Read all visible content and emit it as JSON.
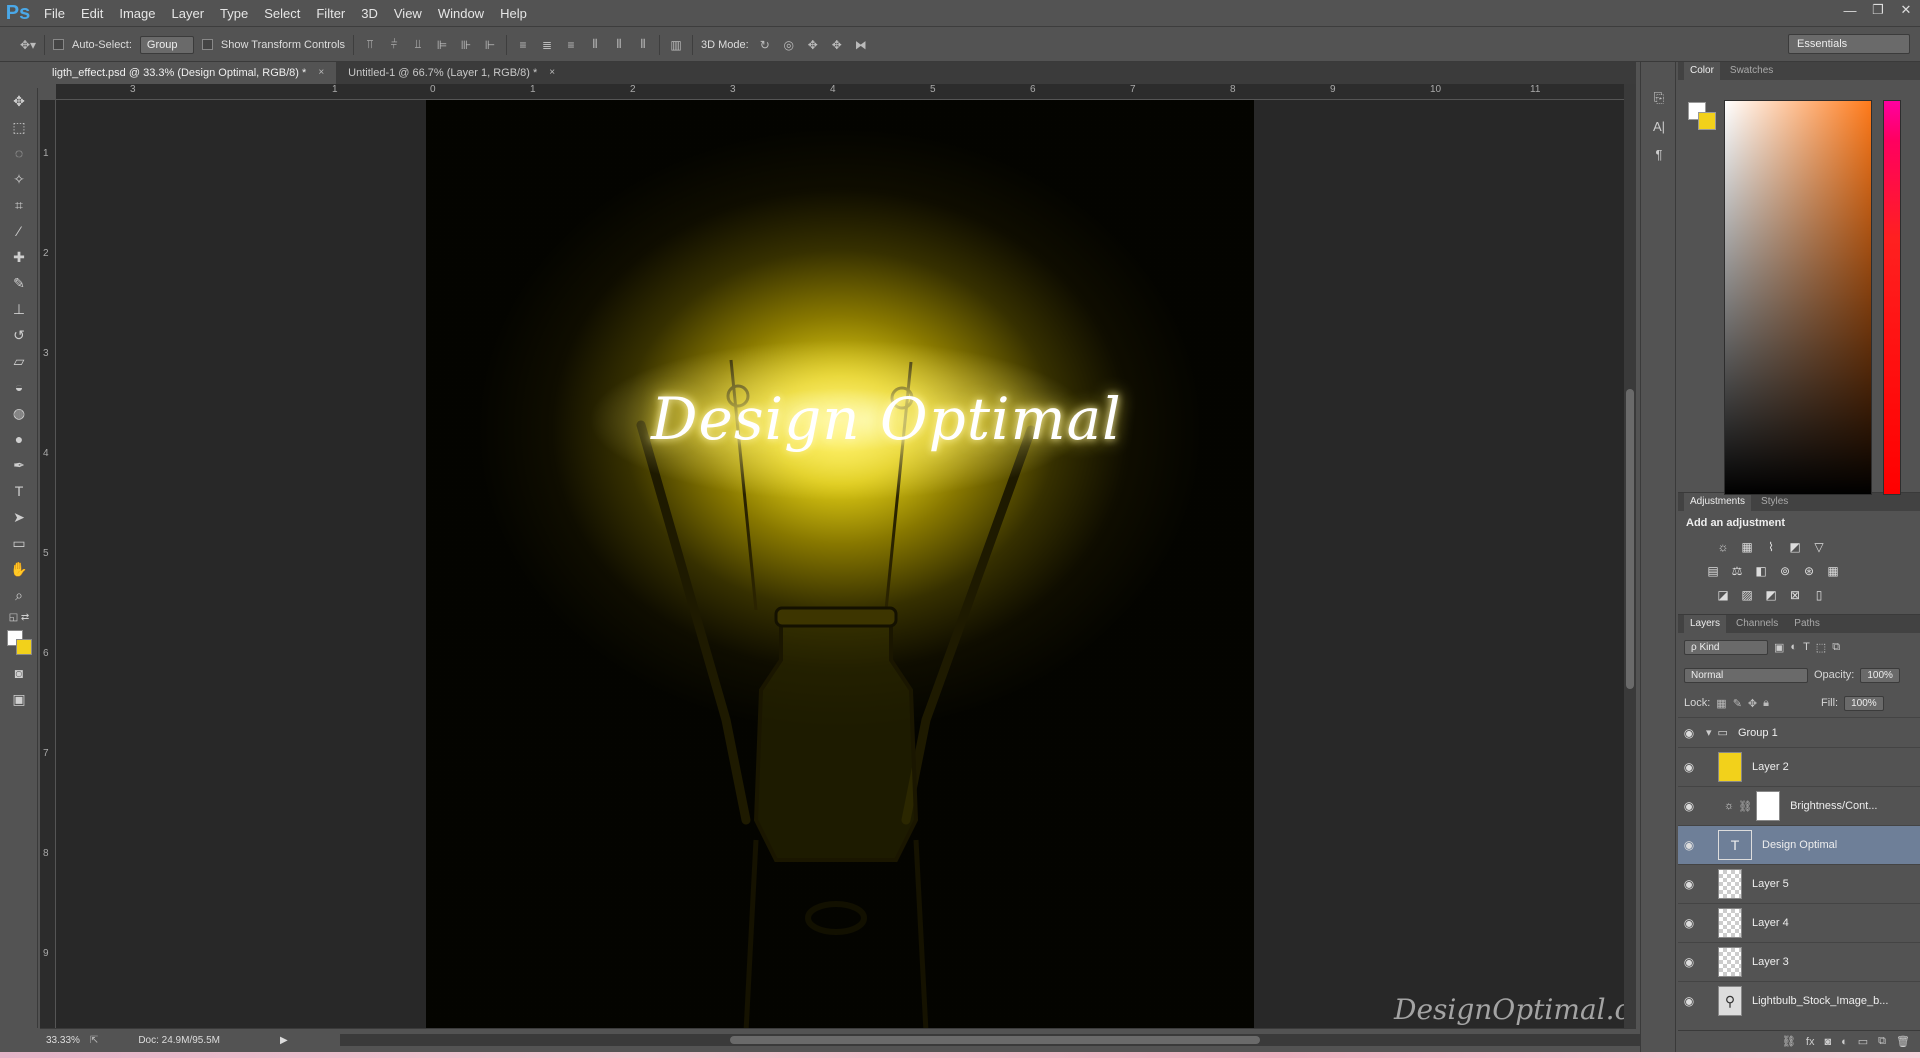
{
  "app": {
    "logo": "Ps"
  },
  "menu": [
    "File",
    "Edit",
    "Image",
    "Layer",
    "Type",
    "Select",
    "Filter",
    "3D",
    "View",
    "Window",
    "Help"
  ],
  "window_controls": [
    "—",
    "❐",
    "✕"
  ],
  "options": {
    "auto_select_label": "Auto-Select:",
    "auto_select_value": "Group",
    "show_transform_label": "Show Transform Controls",
    "mode_3d_label": "3D Mode:",
    "workspace": "Essentials"
  },
  "tabs": [
    {
      "label": "ligth_effect.psd @ 33.3% (Design Optimal, RGB/8) *",
      "close": "×"
    },
    {
      "label": "Untitled-1 @ 66.7% (Layer 1, RGB/8) *",
      "close": "×"
    }
  ],
  "ruler": {
    "h_labels": [
      "3",
      "1",
      "0",
      "1",
      "2",
      "3",
      "4",
      "5",
      "6",
      "7",
      "8",
      "9",
      "10",
      "11"
    ],
    "v_labels": [
      "1",
      "2",
      "3",
      "4",
      "5",
      "6",
      "7",
      "8",
      "9"
    ]
  },
  "canvas": {
    "script_text": "Design Optimal",
    "watermark": "DesignOptimal.com",
    "glow_color": "#f2e21a"
  },
  "status": {
    "zoom": "33.33%",
    "doc": "Doc: 24.9M/95.5M"
  },
  "panels": {
    "color_tabs": [
      "Color",
      "Swatches"
    ],
    "foreground": "#ffffff",
    "background": "#f2d11b",
    "adjust_tabs": [
      "Adjustments",
      "Styles"
    ],
    "add_adjustment": "Add an adjustment",
    "layer_tabs": [
      "Layers",
      "Channels",
      "Paths"
    ],
    "kind_label": "ρ Kind",
    "blend_mode": "Normal",
    "opacity_label": "Opacity:",
    "opacity_value": "100%",
    "lock_label": "Lock:",
    "fill_label": "Fill:",
    "fill_value": "100%"
  },
  "layers": [
    {
      "name": "Group 1",
      "type": "group"
    },
    {
      "name": "Layer 2",
      "type": "fill"
    },
    {
      "name": "Brightness/Cont...",
      "type": "adjust"
    },
    {
      "name": "Design Optimal",
      "type": "text",
      "selected": true
    },
    {
      "name": "Layer 5",
      "type": "empty"
    },
    {
      "name": "Layer 4",
      "type": "empty"
    },
    {
      "name": "Layer 3",
      "type": "empty"
    },
    {
      "name": "Lightbulb_Stock_Image_b...",
      "type": "image"
    }
  ]
}
